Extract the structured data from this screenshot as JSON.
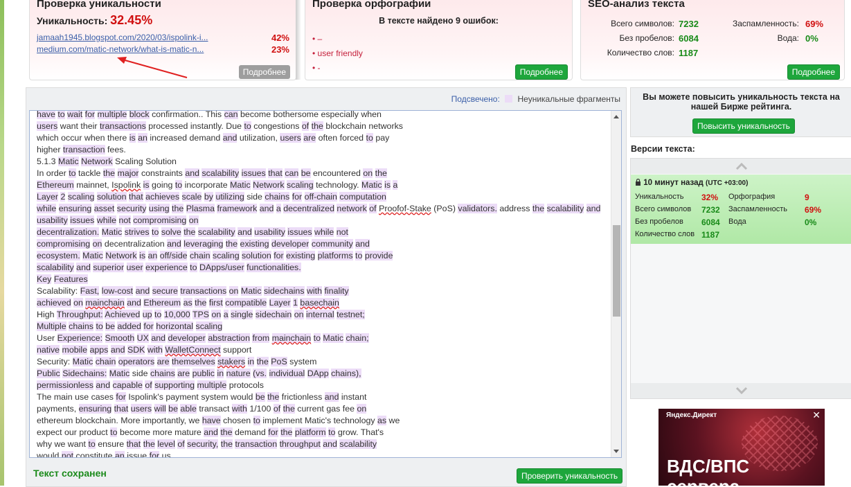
{
  "uniq": {
    "title": "Проверка уникальности",
    "label": "Уникальность:",
    "value": "32.45%",
    "links": [
      {
        "url": "jamaah1945.blogspot.com/2020/03/ispolink-i...",
        "pct": "42%"
      },
      {
        "url": "medium.com/matic-network/what-is-matic-n...",
        "pct": "23%"
      }
    ],
    "more": "Подробнее"
  },
  "spell": {
    "title": "Проверка орфографии",
    "found": "В тексте найдено 9 ошибок:",
    "items": [
      "–",
      "user friendly",
      "-"
    ],
    "more": "Подробнее"
  },
  "seo": {
    "title": "SEO-анализ текста",
    "rows": [
      {
        "l1": "Всего символов:",
        "v1": "7232",
        "l2": "Заспамленность:",
        "v2": "69%"
      },
      {
        "l1": "Без пробелов:",
        "v1": "6084",
        "l2": "Вода:",
        "v2": "0%"
      },
      {
        "l1": "Количество слов:",
        "v1": "1187",
        "l2": "",
        "v2": ""
      }
    ],
    "more": "Подробнее"
  },
  "editor": {
    "highlight_label": "Подсвечено:",
    "highlight_desc": "Неуникальные фрагменты",
    "lines": [
      "have to wait for multiple block confirmation.. This can become bothersome especially when",
      "users want their transactions processed instantly. Due to congestions of the blockchain networks",
      "which occur when there is an increased demand and utilization, users are often forced to pay",
      "higher transaction fees.",
      "5.1.3 Matic Network Scaling Solution",
      "In order to tackle the major constraints and scalability issues that can be encountered on the",
      "Ethereum mainnet, Ispolink is going to incorporate Matic Network scaling technology. Matic is a",
      "Layer 2 scaling solution that achieves scale by utilizing side chains for off-chain computation",
      "while ensuring asset security using the Plasma framework and a decentralized network of Proofof-Stake (PoS) validators. address the scalability and",
      "usability issues while not compromising on",
      "decentralization. Matic strives to solve the scalability and usability issues while not",
      "compromising on decentralization and leveraging the existing developer community and",
      "ecosystem. Matic Network is an off/side chain scaling solution for existing platforms to provide",
      "scalability and superior user experience to DApps/user functionalities.",
      "Key Features",
      "Scalability: Fast, low-cost and secure transactions on Matic sidechains with finality",
      "achieved on mainchain and Ethereum as the first compatible Layer 1 basechain",
      "High Throughput: Achieved up to 10,000 TPS on a single sidechain on internal testnet;",
      "Multiple chains to be added for horizontal scaling",
      "User Experience: Smooth UX and developer abstraction from mainchain to Matic chain;",
      "native mobile apps and SDK with WalletConnect support",
      "Security: Matic chain operators are themselves stakers in the PoS system",
      "Public Sidechains: Matic side chains are public in nature (vs. individual DApp chains),",
      "permissionless and capable of supporting multiple protocols",
      "The main use cases for Ispolink's payment system would be the frictionless and instant",
      "payments, ensuring that users will be able transact with 1/100 of the current gas fee on",
      "ethereum blockchain. More importantly, we have chosen to implement Matic's technology as we",
      "expect our product to become more mature and the demand for the platform to grow. That's",
      "why we want to ensure that the level of security, the transaction throughput and scalability",
      "would not constitute an issue for us."
    ],
    "saved": "Текст сохранен",
    "check_btn": "Проверить уникальность"
  },
  "promo": {
    "text": "Вы можете повысить уникальность текста на нашей Бирже рейтинга.",
    "btn": "Повысить уникальность"
  },
  "versions": {
    "title": "Версии текста:",
    "time": "10 минут назад",
    "tz": "(UTC +03:00)",
    "rows": [
      {
        "l1": "Уникальность",
        "v1": "32%",
        "l2": "Орфография",
        "v2": "9"
      },
      {
        "l1": "Всего символов",
        "v1": "7232",
        "l2": "Заспамленность",
        "v2": "69%"
      },
      {
        "l1": "Без пробелов",
        "v1": "6084",
        "l2": "Вода",
        "v2": "0%"
      },
      {
        "l1": "Количество слов",
        "v1": "1187",
        "l2": "",
        "v2": ""
      }
    ]
  },
  "ad": {
    "label": "Яндекс.Директ",
    "headline": "ВДС/ВПС",
    "headline2": "сервера"
  }
}
